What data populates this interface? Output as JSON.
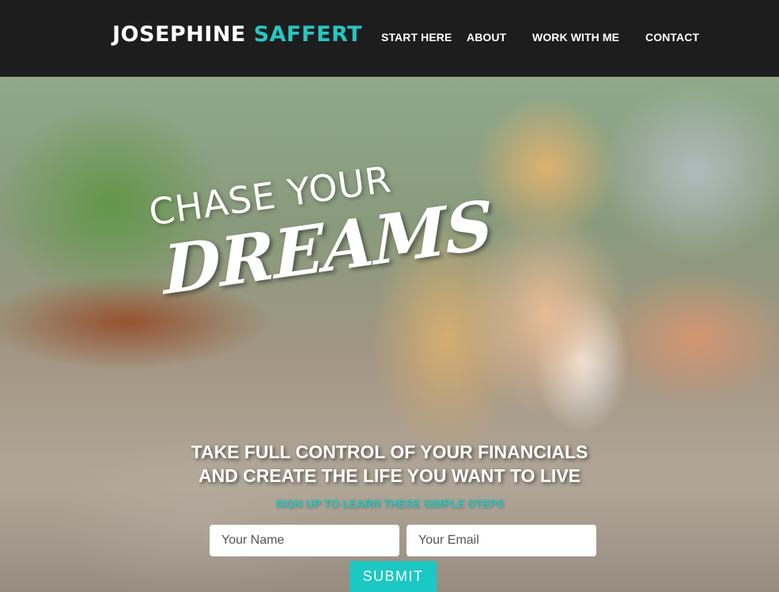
{
  "header": {
    "logo_first": "JOSEPHINE",
    "logo_last": "SAFFERT",
    "nav": [
      "START HERE",
      "ABOUT",
      "WORK WITH ME",
      "CONTACT"
    ]
  },
  "hero": {
    "tagline_small": "CHASE YOUR",
    "tagline_big": "DREAMS",
    "headline_line1": "TAKE FULL CONTROL OF YOUR FINANCIALS",
    "headline_line2": "AND CREATE THE LIFE YOU WANT TO LIVE",
    "subheading": "SIGN UP TO LEARN THESE SIMPLE STEPS"
  },
  "form": {
    "name_placeholder": "Your Name",
    "email_placeholder": "Your Email",
    "submit_label": "SUBMIT"
  },
  "colors": {
    "accent": "#27c7c3",
    "header_bg": "#1d1d1d",
    "button_bg": "#1bc8c4"
  }
}
